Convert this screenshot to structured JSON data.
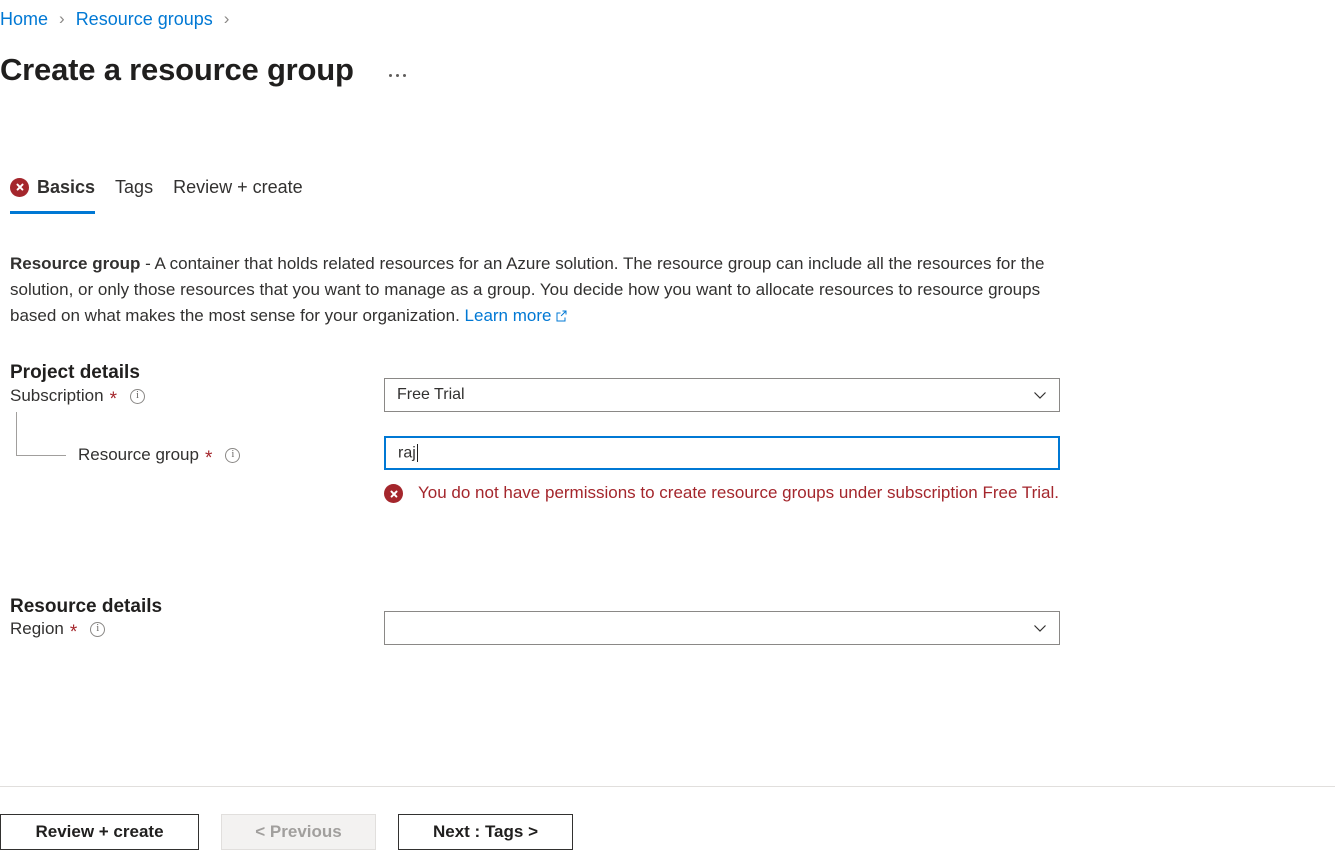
{
  "breadcrumb": {
    "items": [
      {
        "label": "Home"
      },
      {
        "label": "Resource groups"
      }
    ],
    "separator": "›"
  },
  "header": {
    "title": "Create a resource group",
    "more_menu": "…"
  },
  "tabs": [
    {
      "label": "Basics",
      "active": true,
      "has_error": true
    },
    {
      "label": "Tags",
      "active": false,
      "has_error": false
    },
    {
      "label": "Review + create",
      "active": false,
      "has_error": false
    }
  ],
  "description": {
    "lead": "Resource group",
    "body": " - A container that holds related resources for an Azure solution. The resource group can include all the resources for the solution, or only those resources that you want to manage as a group. You decide how you want to allocate resources to resource groups based on what makes the most sense for your organization. ",
    "link_label": "Learn more"
  },
  "sections": {
    "project_details": {
      "heading": "Project details",
      "fields": {
        "subscription": {
          "label": "Subscription",
          "required_marker": "*",
          "value": "Free Trial",
          "placeholder": ""
        },
        "resource_group": {
          "label": "Resource group",
          "required_marker": "*",
          "value": "raj",
          "placeholder": "",
          "error": "You do not have permissions to create resource groups under subscription Free Trial."
        }
      }
    },
    "resource_details": {
      "heading": "Resource details",
      "fields": {
        "region": {
          "label": "Region",
          "required_marker": "*",
          "value": "",
          "placeholder": ""
        }
      }
    }
  },
  "footer": {
    "buttons": [
      {
        "label": "Review + create",
        "disabled": false
      },
      {
        "label": "< Previous",
        "disabled": true
      },
      {
        "label": "Next : Tags >",
        "disabled": false
      }
    ]
  },
  "colors": {
    "accent": "#0078d4",
    "error": "#a4262c",
    "text": "#323130",
    "border": "#8a8886"
  }
}
